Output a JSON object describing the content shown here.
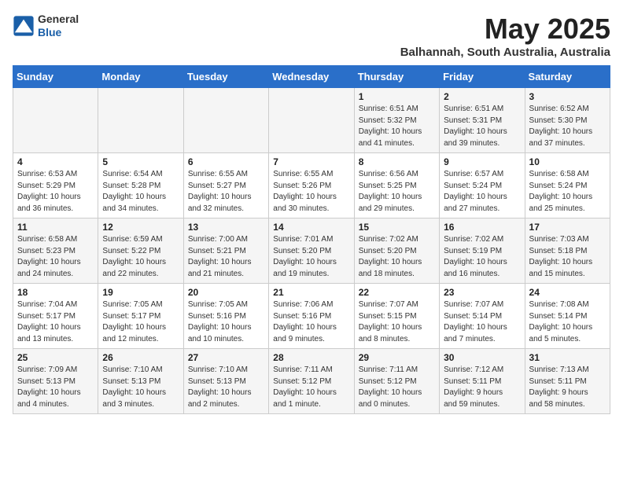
{
  "header": {
    "logo_general": "General",
    "logo_blue": "Blue",
    "month_year": "May 2025",
    "location": "Balhannah, South Australia, Australia"
  },
  "days_of_week": [
    "Sunday",
    "Monday",
    "Tuesday",
    "Wednesday",
    "Thursday",
    "Friday",
    "Saturday"
  ],
  "weeks": [
    [
      {
        "day": "",
        "info": ""
      },
      {
        "day": "",
        "info": ""
      },
      {
        "day": "",
        "info": ""
      },
      {
        "day": "",
        "info": ""
      },
      {
        "day": "1",
        "info": "Sunrise: 6:51 AM\nSunset: 5:32 PM\nDaylight: 10 hours\nand 41 minutes."
      },
      {
        "day": "2",
        "info": "Sunrise: 6:51 AM\nSunset: 5:31 PM\nDaylight: 10 hours\nand 39 minutes."
      },
      {
        "day": "3",
        "info": "Sunrise: 6:52 AM\nSunset: 5:30 PM\nDaylight: 10 hours\nand 37 minutes."
      }
    ],
    [
      {
        "day": "4",
        "info": "Sunrise: 6:53 AM\nSunset: 5:29 PM\nDaylight: 10 hours\nand 36 minutes."
      },
      {
        "day": "5",
        "info": "Sunrise: 6:54 AM\nSunset: 5:28 PM\nDaylight: 10 hours\nand 34 minutes."
      },
      {
        "day": "6",
        "info": "Sunrise: 6:55 AM\nSunset: 5:27 PM\nDaylight: 10 hours\nand 32 minutes."
      },
      {
        "day": "7",
        "info": "Sunrise: 6:55 AM\nSunset: 5:26 PM\nDaylight: 10 hours\nand 30 minutes."
      },
      {
        "day": "8",
        "info": "Sunrise: 6:56 AM\nSunset: 5:25 PM\nDaylight: 10 hours\nand 29 minutes."
      },
      {
        "day": "9",
        "info": "Sunrise: 6:57 AM\nSunset: 5:24 PM\nDaylight: 10 hours\nand 27 minutes."
      },
      {
        "day": "10",
        "info": "Sunrise: 6:58 AM\nSunset: 5:24 PM\nDaylight: 10 hours\nand 25 minutes."
      }
    ],
    [
      {
        "day": "11",
        "info": "Sunrise: 6:58 AM\nSunset: 5:23 PM\nDaylight: 10 hours\nand 24 minutes."
      },
      {
        "day": "12",
        "info": "Sunrise: 6:59 AM\nSunset: 5:22 PM\nDaylight: 10 hours\nand 22 minutes."
      },
      {
        "day": "13",
        "info": "Sunrise: 7:00 AM\nSunset: 5:21 PM\nDaylight: 10 hours\nand 21 minutes."
      },
      {
        "day": "14",
        "info": "Sunrise: 7:01 AM\nSunset: 5:20 PM\nDaylight: 10 hours\nand 19 minutes."
      },
      {
        "day": "15",
        "info": "Sunrise: 7:02 AM\nSunset: 5:20 PM\nDaylight: 10 hours\nand 18 minutes."
      },
      {
        "day": "16",
        "info": "Sunrise: 7:02 AM\nSunset: 5:19 PM\nDaylight: 10 hours\nand 16 minutes."
      },
      {
        "day": "17",
        "info": "Sunrise: 7:03 AM\nSunset: 5:18 PM\nDaylight: 10 hours\nand 15 minutes."
      }
    ],
    [
      {
        "day": "18",
        "info": "Sunrise: 7:04 AM\nSunset: 5:17 PM\nDaylight: 10 hours\nand 13 minutes."
      },
      {
        "day": "19",
        "info": "Sunrise: 7:05 AM\nSunset: 5:17 PM\nDaylight: 10 hours\nand 12 minutes."
      },
      {
        "day": "20",
        "info": "Sunrise: 7:05 AM\nSunset: 5:16 PM\nDaylight: 10 hours\nand 10 minutes."
      },
      {
        "day": "21",
        "info": "Sunrise: 7:06 AM\nSunset: 5:16 PM\nDaylight: 10 hours\nand 9 minutes."
      },
      {
        "day": "22",
        "info": "Sunrise: 7:07 AM\nSunset: 5:15 PM\nDaylight: 10 hours\nand 8 minutes."
      },
      {
        "day": "23",
        "info": "Sunrise: 7:07 AM\nSunset: 5:14 PM\nDaylight: 10 hours\nand 7 minutes."
      },
      {
        "day": "24",
        "info": "Sunrise: 7:08 AM\nSunset: 5:14 PM\nDaylight: 10 hours\nand 5 minutes."
      }
    ],
    [
      {
        "day": "25",
        "info": "Sunrise: 7:09 AM\nSunset: 5:13 PM\nDaylight: 10 hours\nand 4 minutes."
      },
      {
        "day": "26",
        "info": "Sunrise: 7:10 AM\nSunset: 5:13 PM\nDaylight: 10 hours\nand 3 minutes."
      },
      {
        "day": "27",
        "info": "Sunrise: 7:10 AM\nSunset: 5:13 PM\nDaylight: 10 hours\nand 2 minutes."
      },
      {
        "day": "28",
        "info": "Sunrise: 7:11 AM\nSunset: 5:12 PM\nDaylight: 10 hours\nand 1 minute."
      },
      {
        "day": "29",
        "info": "Sunrise: 7:11 AM\nSunset: 5:12 PM\nDaylight: 10 hours\nand 0 minutes."
      },
      {
        "day": "30",
        "info": "Sunrise: 7:12 AM\nSunset: 5:11 PM\nDaylight: 9 hours\nand 59 minutes."
      },
      {
        "day": "31",
        "info": "Sunrise: 7:13 AM\nSunset: 5:11 PM\nDaylight: 9 hours\nand 58 minutes."
      }
    ]
  ]
}
